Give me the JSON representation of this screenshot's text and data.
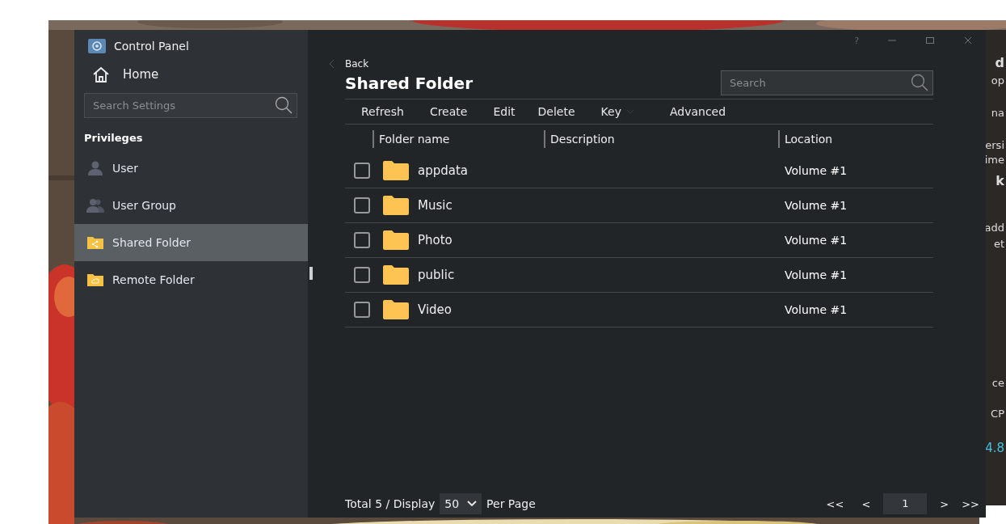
{
  "window": {
    "title": "Control Panel",
    "help": "?"
  },
  "sidebar": {
    "home": "Home",
    "search": {
      "placeholder": "Search Settings"
    },
    "section": "Privileges",
    "items": [
      {
        "label": "User",
        "kind": "user",
        "selected": false
      },
      {
        "label": "User Group",
        "kind": "group",
        "selected": false
      },
      {
        "label": "Shared Folder",
        "kind": "shared",
        "selected": true
      },
      {
        "label": "Remote Folder",
        "kind": "remote",
        "selected": false
      }
    ]
  },
  "main": {
    "back": "Back",
    "heading": "Shared Folder",
    "search": {
      "placeholder": "Search"
    },
    "toolbar": [
      {
        "label": "Refresh",
        "dropdown": false
      },
      {
        "label": "Create",
        "dropdown": false
      },
      {
        "label": "Edit",
        "dropdown": false
      },
      {
        "label": "Delete",
        "dropdown": false
      },
      {
        "label": "Key",
        "dropdown": true
      },
      {
        "label": "Advanced",
        "dropdown": false
      }
    ],
    "table": {
      "columns": [
        "Folder name",
        "Description",
        "Location"
      ],
      "rows": [
        {
          "name": "appdata",
          "location": "Volume #1",
          "checked": false
        },
        {
          "name": "Music",
          "location": "Volume #1",
          "checked": false
        },
        {
          "name": "Photo",
          "location": "Volume #1",
          "checked": false
        },
        {
          "name": "public",
          "location": "Volume #1",
          "checked": false
        },
        {
          "name": "Video",
          "location": "Volume #1",
          "checked": false
        }
      ]
    },
    "footer": {
      "total": "Total 5 / Display",
      "page_size": "50",
      "per_page": "Per Page",
      "pager": [
        "<<",
        "<",
        "1",
        ">",
        ">>"
      ]
    }
  },
  "background_window": {
    "fragments": [
      "d",
      "op",
      "na",
      "ersi",
      "ime",
      "k",
      "add",
      "et",
      "ce",
      "CP",
      "4.8"
    ]
  }
}
